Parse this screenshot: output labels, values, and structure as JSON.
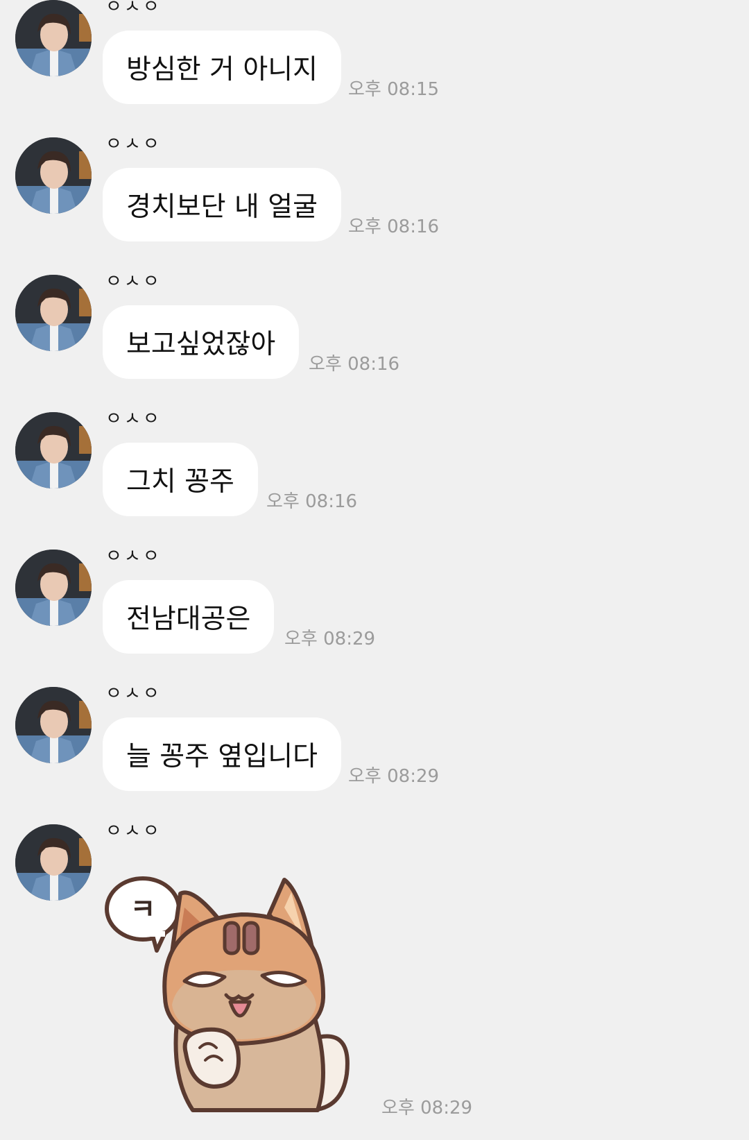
{
  "chat": {
    "sender_name": "ㅇㅅㅇ",
    "messages": [
      {
        "text": "방심한 거 아니지",
        "time": "오후 08:15"
      },
      {
        "text": "경치보단 내 얼굴",
        "time": "오후 08:16"
      },
      {
        "text": "보고싶었잖아",
        "time": "오후 08:16"
      },
      {
        "text": "그치 꽁주",
        "time": "오후 08:16"
      },
      {
        "text": "전남대공은",
        "time": "오후 08:29"
      },
      {
        "text": "늘 꽁주 옆입니다",
        "time": "오후 08:29"
      }
    ],
    "sticker_message": {
      "speech_bubble_text": "ㅋ",
      "time": "오후 08:29"
    }
  },
  "colors": {
    "background": "#f0f0f0",
    "bubble": "#ffffff",
    "time_text": "#9b9b9b",
    "sticker_fur": "#e0a377"
  }
}
